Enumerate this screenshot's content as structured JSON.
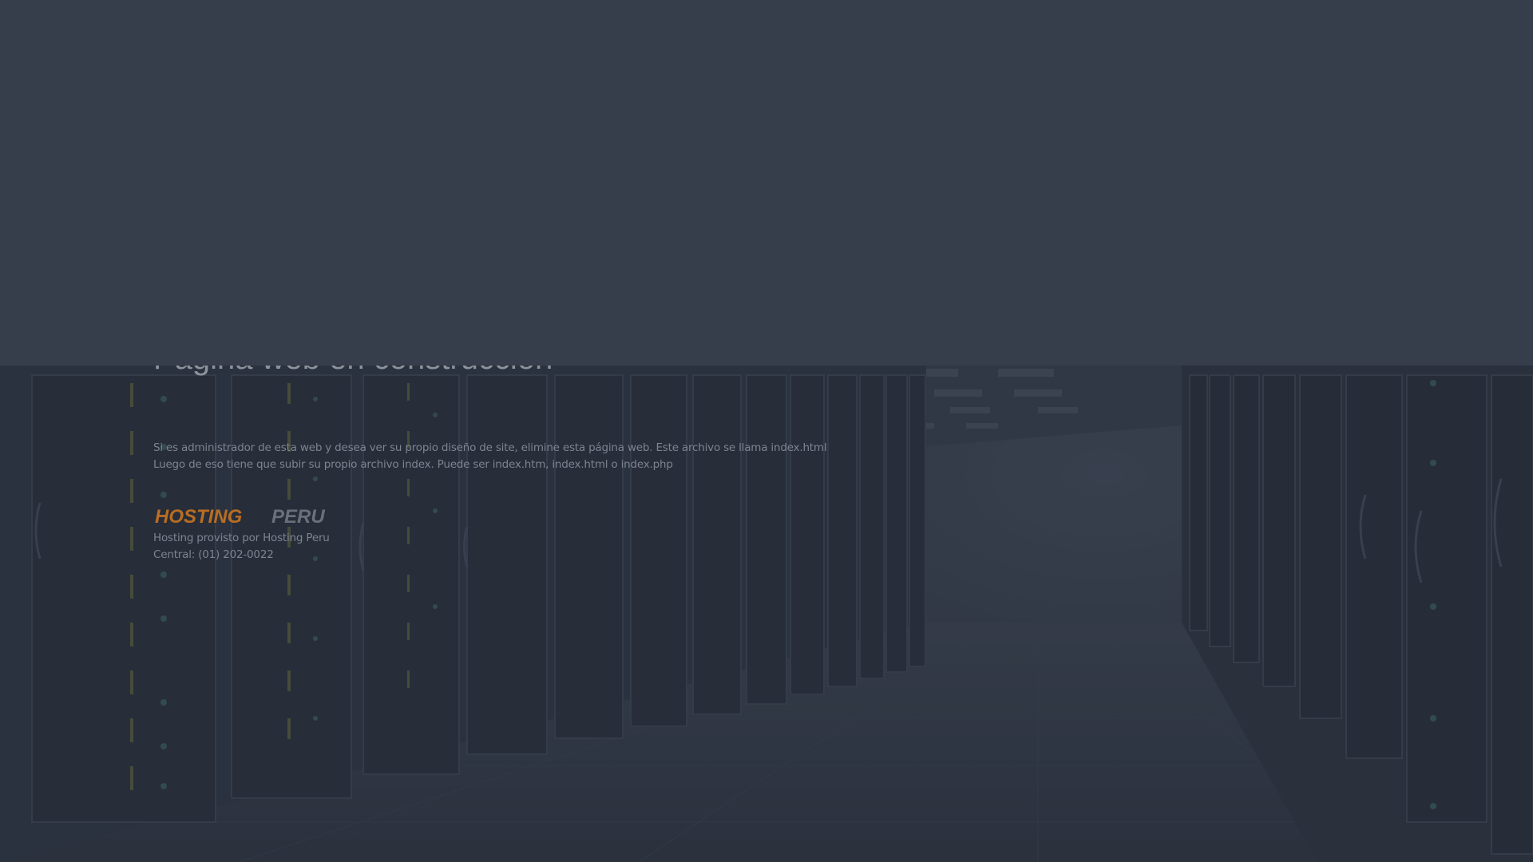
{
  "page": {
    "title": "Página web en construcción"
  },
  "message": {
    "line1": "Si es administrador de esta web y desea ver su propio diseño de site, elimine esta página web. Este archivo se llama index.html",
    "line2": "Luego de eso tiene que subir su propio archivo index. Puede ser index.htm, index.html o index.php"
  },
  "brand": {
    "logo_part1": "HOSTING",
    "logo_part2": "PERU",
    "provided_by": "Hosting provisto por Hosting Peru",
    "phone": "Central: (01) 202-0022"
  },
  "colors": {
    "top_band": "#363e4b",
    "background": "#2a313d",
    "logo_orange": "#b86d23",
    "logo_gray": "#6a717b",
    "text": "#7c8591"
  }
}
